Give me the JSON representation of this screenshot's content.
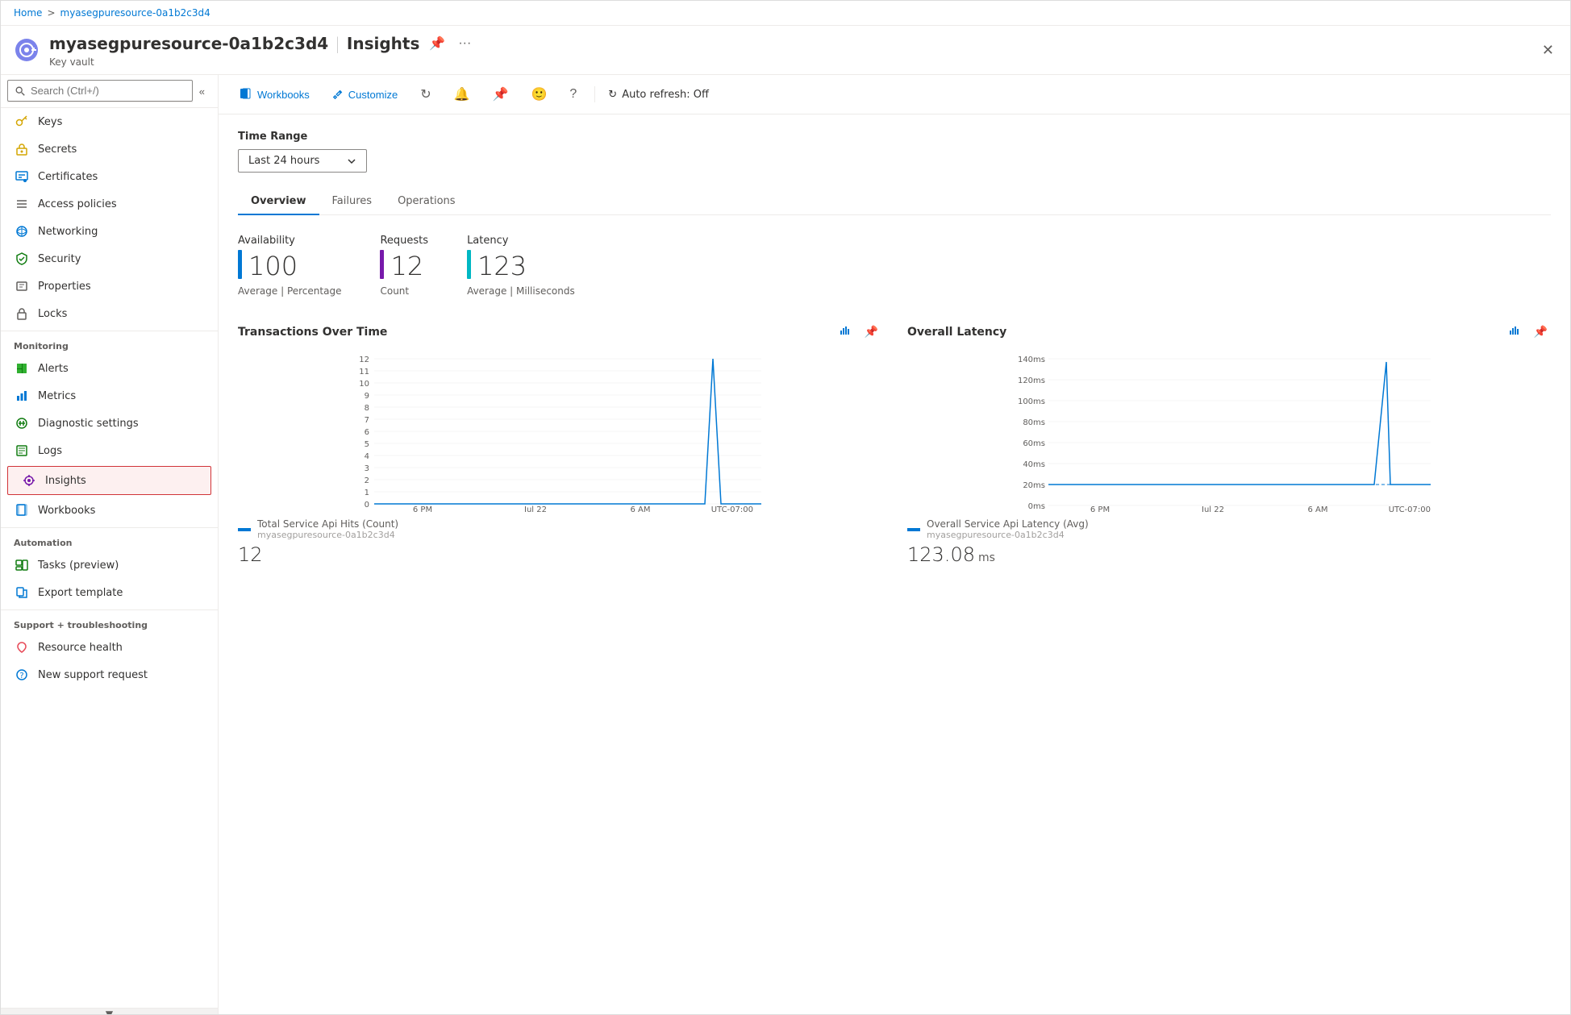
{
  "breadcrumb": {
    "home": "Home",
    "separator": ">",
    "current": "myasegpuresource-0a1b2c3d4"
  },
  "header": {
    "title": "myasegpuresource-0a1b2c3d4",
    "separator": "|",
    "page_name": "Insights",
    "subtitle": "Key vault",
    "pin_label": "📌",
    "more_label": "···",
    "close_label": "✕"
  },
  "sidebar": {
    "search_placeholder": "Search (Ctrl+/)",
    "collapse_label": "«",
    "nav_items": [
      {
        "id": "keys",
        "label": "Keys",
        "icon": "key"
      },
      {
        "id": "secrets",
        "label": "Secrets",
        "icon": "secret"
      },
      {
        "id": "certificates",
        "label": "Certificates",
        "icon": "cert"
      },
      {
        "id": "access-policies",
        "label": "Access policies",
        "icon": "access"
      },
      {
        "id": "networking",
        "label": "Networking",
        "icon": "network"
      },
      {
        "id": "security",
        "label": "Security",
        "icon": "security"
      },
      {
        "id": "properties",
        "label": "Properties",
        "icon": "properties"
      },
      {
        "id": "locks",
        "label": "Locks",
        "icon": "locks"
      }
    ],
    "monitoring_label": "Monitoring",
    "monitoring_items": [
      {
        "id": "alerts",
        "label": "Alerts",
        "icon": "alerts"
      },
      {
        "id": "metrics",
        "label": "Metrics",
        "icon": "metrics"
      },
      {
        "id": "diagnostic-settings",
        "label": "Diagnostic settings",
        "icon": "diag"
      },
      {
        "id": "logs",
        "label": "Logs",
        "icon": "logs"
      },
      {
        "id": "insights",
        "label": "Insights",
        "icon": "insights",
        "active": true,
        "highlighted": true
      },
      {
        "id": "workbooks",
        "label": "Workbooks",
        "icon": "workbooks"
      }
    ],
    "automation_label": "Automation",
    "automation_items": [
      {
        "id": "tasks",
        "label": "Tasks (preview)",
        "icon": "tasks"
      },
      {
        "id": "export",
        "label": "Export template",
        "icon": "export"
      }
    ],
    "support_label": "Support + troubleshooting",
    "support_items": [
      {
        "id": "resource-health",
        "label": "Resource health",
        "icon": "health"
      },
      {
        "id": "new-support",
        "label": "New support request",
        "icon": "support"
      }
    ]
  },
  "toolbar": {
    "workbooks_label": "Workbooks",
    "customize_label": "Customize",
    "auto_refresh_label": "Auto refresh: Off"
  },
  "time_range": {
    "label": "Time Range",
    "value": "Last 24 hours"
  },
  "tabs": [
    {
      "id": "overview",
      "label": "Overview",
      "active": true
    },
    {
      "id": "failures",
      "label": "Failures",
      "active": false
    },
    {
      "id": "operations",
      "label": "Operations",
      "active": false
    }
  ],
  "metrics": [
    {
      "label": "Availability",
      "value": "100",
      "sub": "Average | Percentage",
      "bar_color": "#0078d4"
    },
    {
      "label": "Requests",
      "value": "12",
      "sub": "Count",
      "bar_color": "#7719aa"
    },
    {
      "label": "Latency",
      "value": "123",
      "sub": "Average | Milliseconds",
      "bar_color": "#00b7c3"
    }
  ],
  "charts": {
    "transactions": {
      "title": "Transactions Over Time",
      "y_labels": [
        "12",
        "11",
        "10",
        "9",
        "8",
        "7",
        "6",
        "5",
        "4",
        "3",
        "2",
        "1",
        "0"
      ],
      "x_labels": [
        "6 PM",
        "Jul 22",
        "6 AM",
        "UTC-07:00"
      ],
      "legend_label": "Total Service Api Hits (Count)",
      "legend_sub": "myasegpuresource-0a1b2c3d4",
      "value": "12"
    },
    "latency": {
      "title": "Overall Latency",
      "y_labels": [
        "140ms",
        "120ms",
        "100ms",
        "80ms",
        "60ms",
        "40ms",
        "20ms",
        "0ms"
      ],
      "x_labels": [
        "6 PM",
        "Jul 22",
        "6 AM",
        "UTC-07:00"
      ],
      "legend_label": "Overall Service Api Latency (Avg)",
      "legend_sub": "myasegpuresource-0a1b2c3d4",
      "value": "123.08",
      "value_unit": "ms"
    }
  }
}
